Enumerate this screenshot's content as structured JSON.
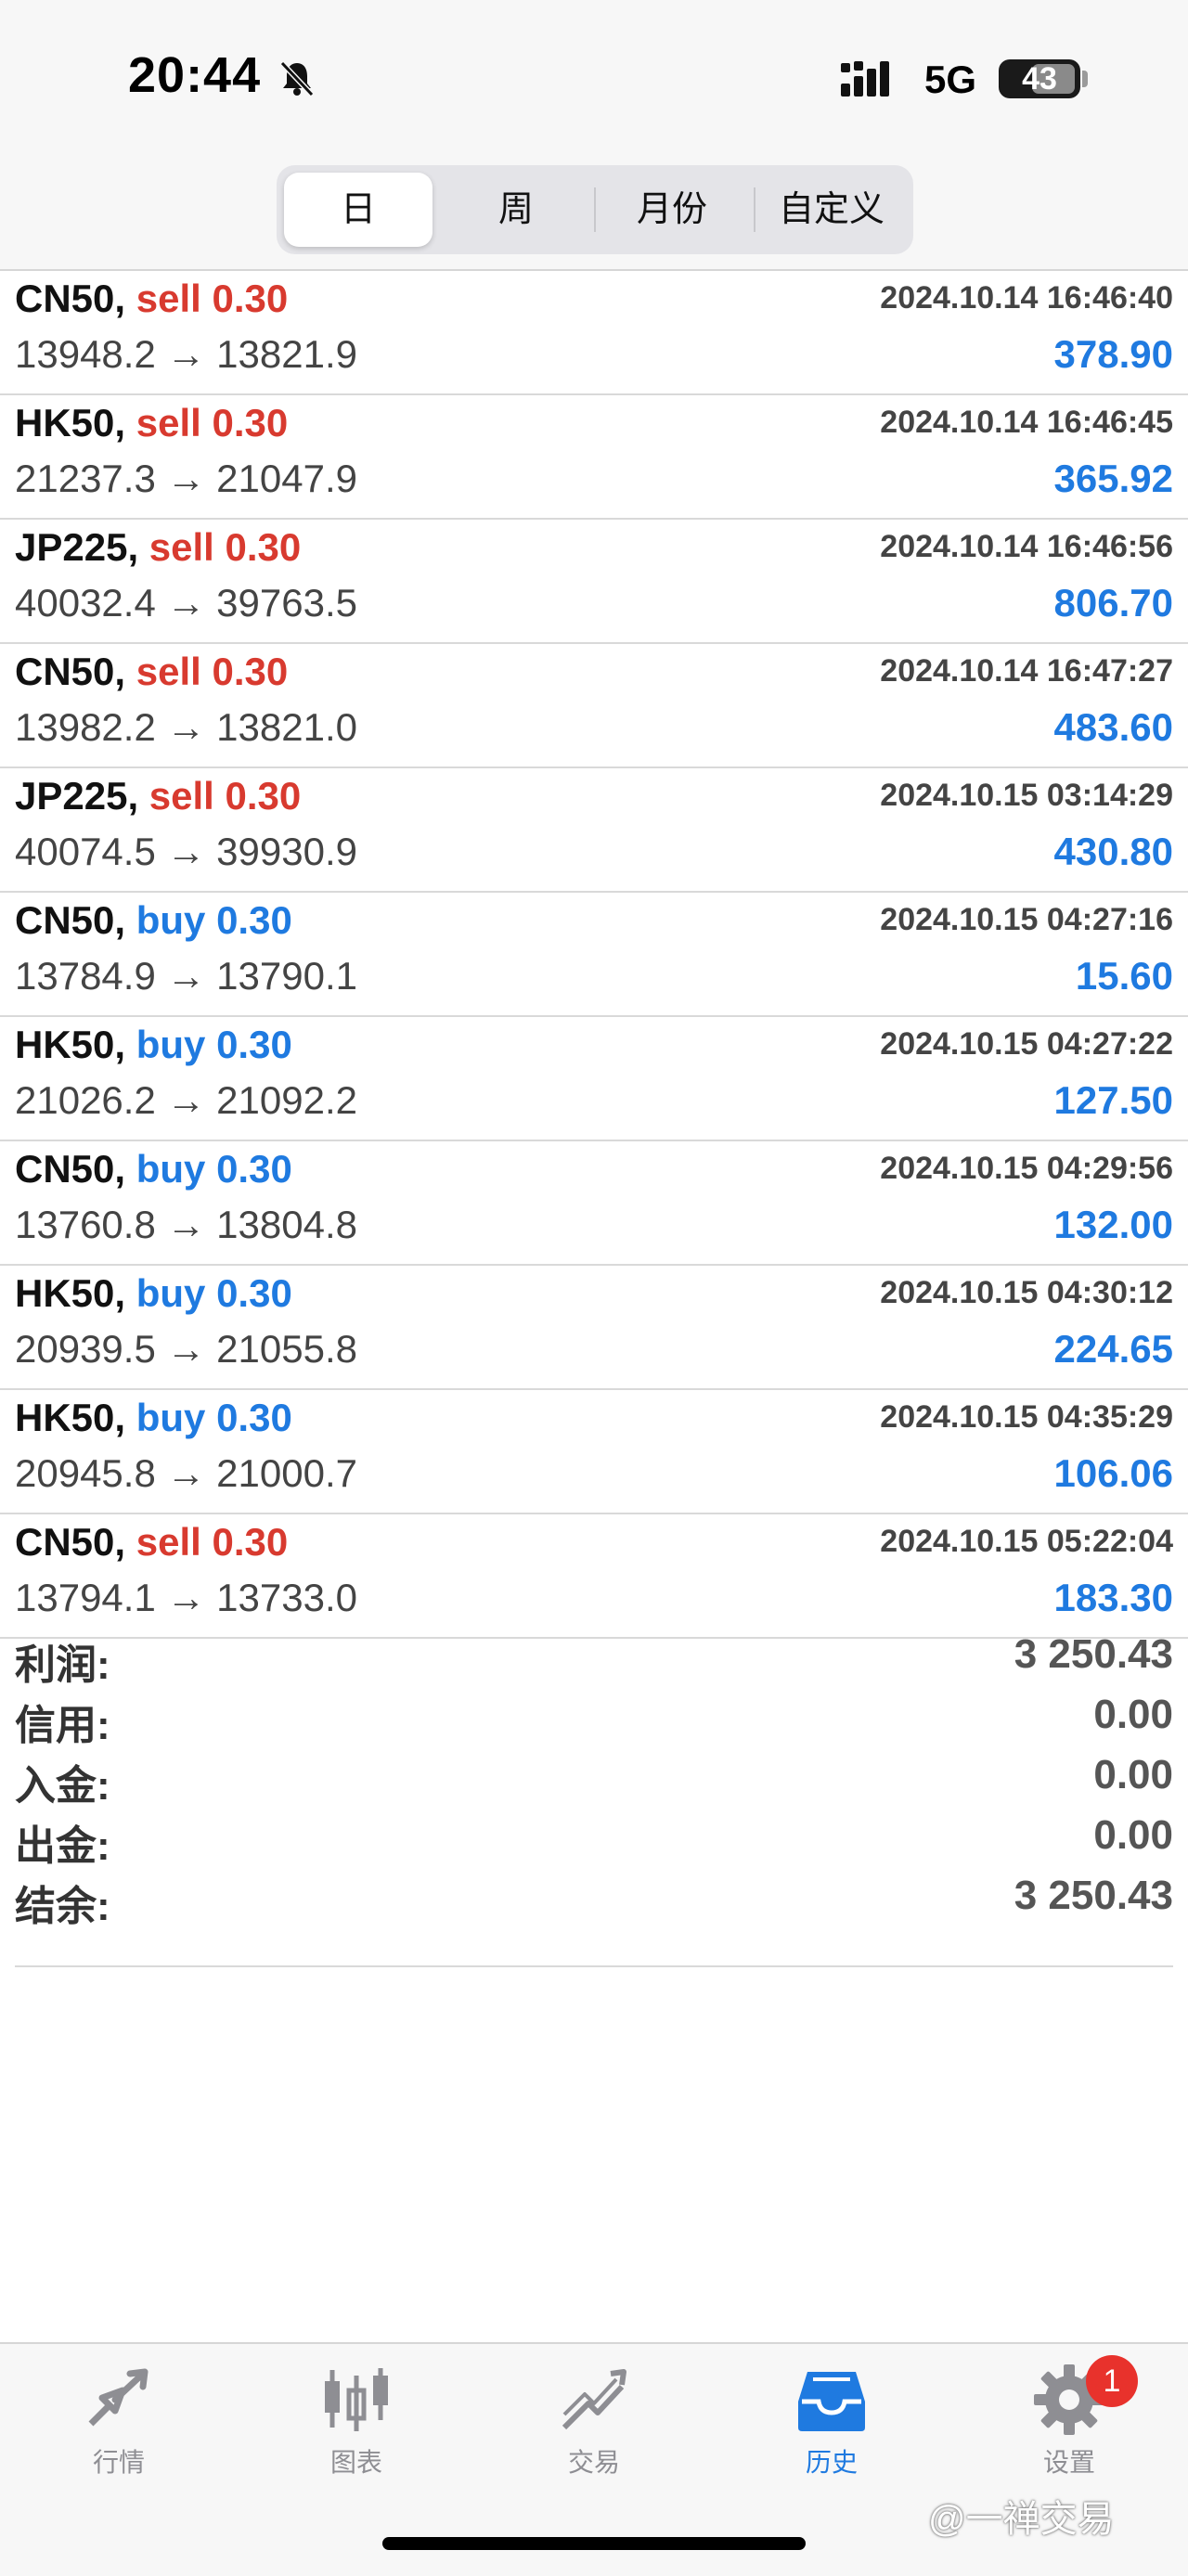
{
  "status": {
    "time": "20:44",
    "network": "5G",
    "battery": "43"
  },
  "periods": {
    "items": [
      "日",
      "周",
      "月份",
      "自定义"
    ],
    "active_index": 0
  },
  "trades": [
    {
      "symbol": "CN50,",
      "side": "sell",
      "volume": "0.30",
      "datetime": "2024.10.14 16:46:40",
      "prices": "13948.2 → 13821.9",
      "profit": "378.90"
    },
    {
      "symbol": "HK50,",
      "side": "sell",
      "volume": "0.30",
      "datetime": "2024.10.14 16:46:45",
      "prices": "21237.3 → 21047.9",
      "profit": "365.92"
    },
    {
      "symbol": "JP225,",
      "side": "sell",
      "volume": "0.30",
      "datetime": "2024.10.14 16:46:56",
      "prices": "40032.4 → 39763.5",
      "profit": "806.70"
    },
    {
      "symbol": "CN50,",
      "side": "sell",
      "volume": "0.30",
      "datetime": "2024.10.14 16:47:27",
      "prices": "13982.2 → 13821.0",
      "profit": "483.60"
    },
    {
      "symbol": "JP225,",
      "side": "sell",
      "volume": "0.30",
      "datetime": "2024.10.15 03:14:29",
      "prices": "40074.5 → 39930.9",
      "profit": "430.80"
    },
    {
      "symbol": "CN50,",
      "side": "buy",
      "volume": "0.30",
      "datetime": "2024.10.15 04:27:16",
      "prices": "13784.9 → 13790.1",
      "profit": "15.60"
    },
    {
      "symbol": "HK50,",
      "side": "buy",
      "volume": "0.30",
      "datetime": "2024.10.15 04:27:22",
      "prices": "21026.2 → 21092.2",
      "profit": "127.50"
    },
    {
      "symbol": "CN50,",
      "side": "buy",
      "volume": "0.30",
      "datetime": "2024.10.15 04:29:56",
      "prices": "13760.8 → 13804.8",
      "profit": "132.00"
    },
    {
      "symbol": "HK50,",
      "side": "buy",
      "volume": "0.30",
      "datetime": "2024.10.15 04:30:12",
      "prices": "20939.5 → 21055.8",
      "profit": "224.65"
    },
    {
      "symbol": "HK50,",
      "side": "buy",
      "volume": "0.30",
      "datetime": "2024.10.15 04:35:29",
      "prices": "20945.8 → 21000.7",
      "profit": "106.06"
    },
    {
      "symbol": "CN50,",
      "side": "sell",
      "volume": "0.30",
      "datetime": "2024.10.15 05:22:04",
      "prices": "13794.1 → 13733.0",
      "profit": "183.30"
    }
  ],
  "summary": [
    {
      "label": "利润:",
      "value": "3 250.43"
    },
    {
      "label": "信用:",
      "value": "0.00"
    },
    {
      "label": "入金:",
      "value": "0.00"
    },
    {
      "label": "出金:",
      "value": "0.00"
    },
    {
      "label": "结余:",
      "value": "3 250.43"
    }
  ],
  "tabs": [
    {
      "label": "行情",
      "icon": "quotes-arrows-icon"
    },
    {
      "label": "图表",
      "icon": "candlestick-chart-icon"
    },
    {
      "label": "交易",
      "icon": "trade-trend-icon"
    },
    {
      "label": "历史",
      "icon": "history-tray-icon",
      "active": true
    },
    {
      "label": "设置",
      "icon": "gear-icon",
      "badge": "1"
    }
  ],
  "watermark": "@一禅交易",
  "colors": {
    "sell": "#d83a2f",
    "buy": "#1f7ae0",
    "profit": "#1f7ae0",
    "active_tab": "#1f7ae0",
    "badge": "#e8322c"
  }
}
